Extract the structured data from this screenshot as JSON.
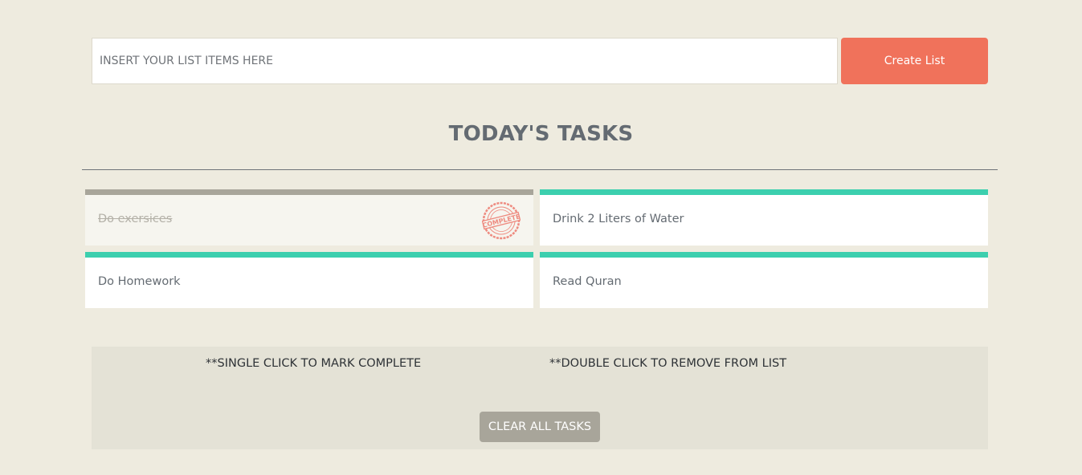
{
  "input": {
    "placeholder": "INSERT YOUR LIST ITEMS HERE",
    "value": ""
  },
  "create_button": {
    "label": "Create List"
  },
  "title": "TODAY'S TASKS",
  "tasks": [
    {
      "label": "Do exersices",
      "completed": true
    },
    {
      "label": "Drink 2 Liters of Water",
      "completed": false
    },
    {
      "label": "Do Homework",
      "completed": false
    },
    {
      "label": "Read Quran",
      "completed": false
    }
  ],
  "stamp": {
    "text": "COMPLETE",
    "icon": "complete-stamp-icon"
  },
  "hints": {
    "single": "**SINGLE CLICK TO MARK COMPLETE",
    "double": "**DOUBLE CLICK TO REMOVE FROM LIST"
  },
  "clear_button": {
    "label": "CLEAR ALL TASKS"
  },
  "colors": {
    "background": "#eeebdf",
    "accent": "#f0725b",
    "task_bar": "#3ccfae",
    "task_done_bar": "#a8a59a",
    "panel": "#e4e2d6",
    "stamp": "#ee8a7f"
  }
}
